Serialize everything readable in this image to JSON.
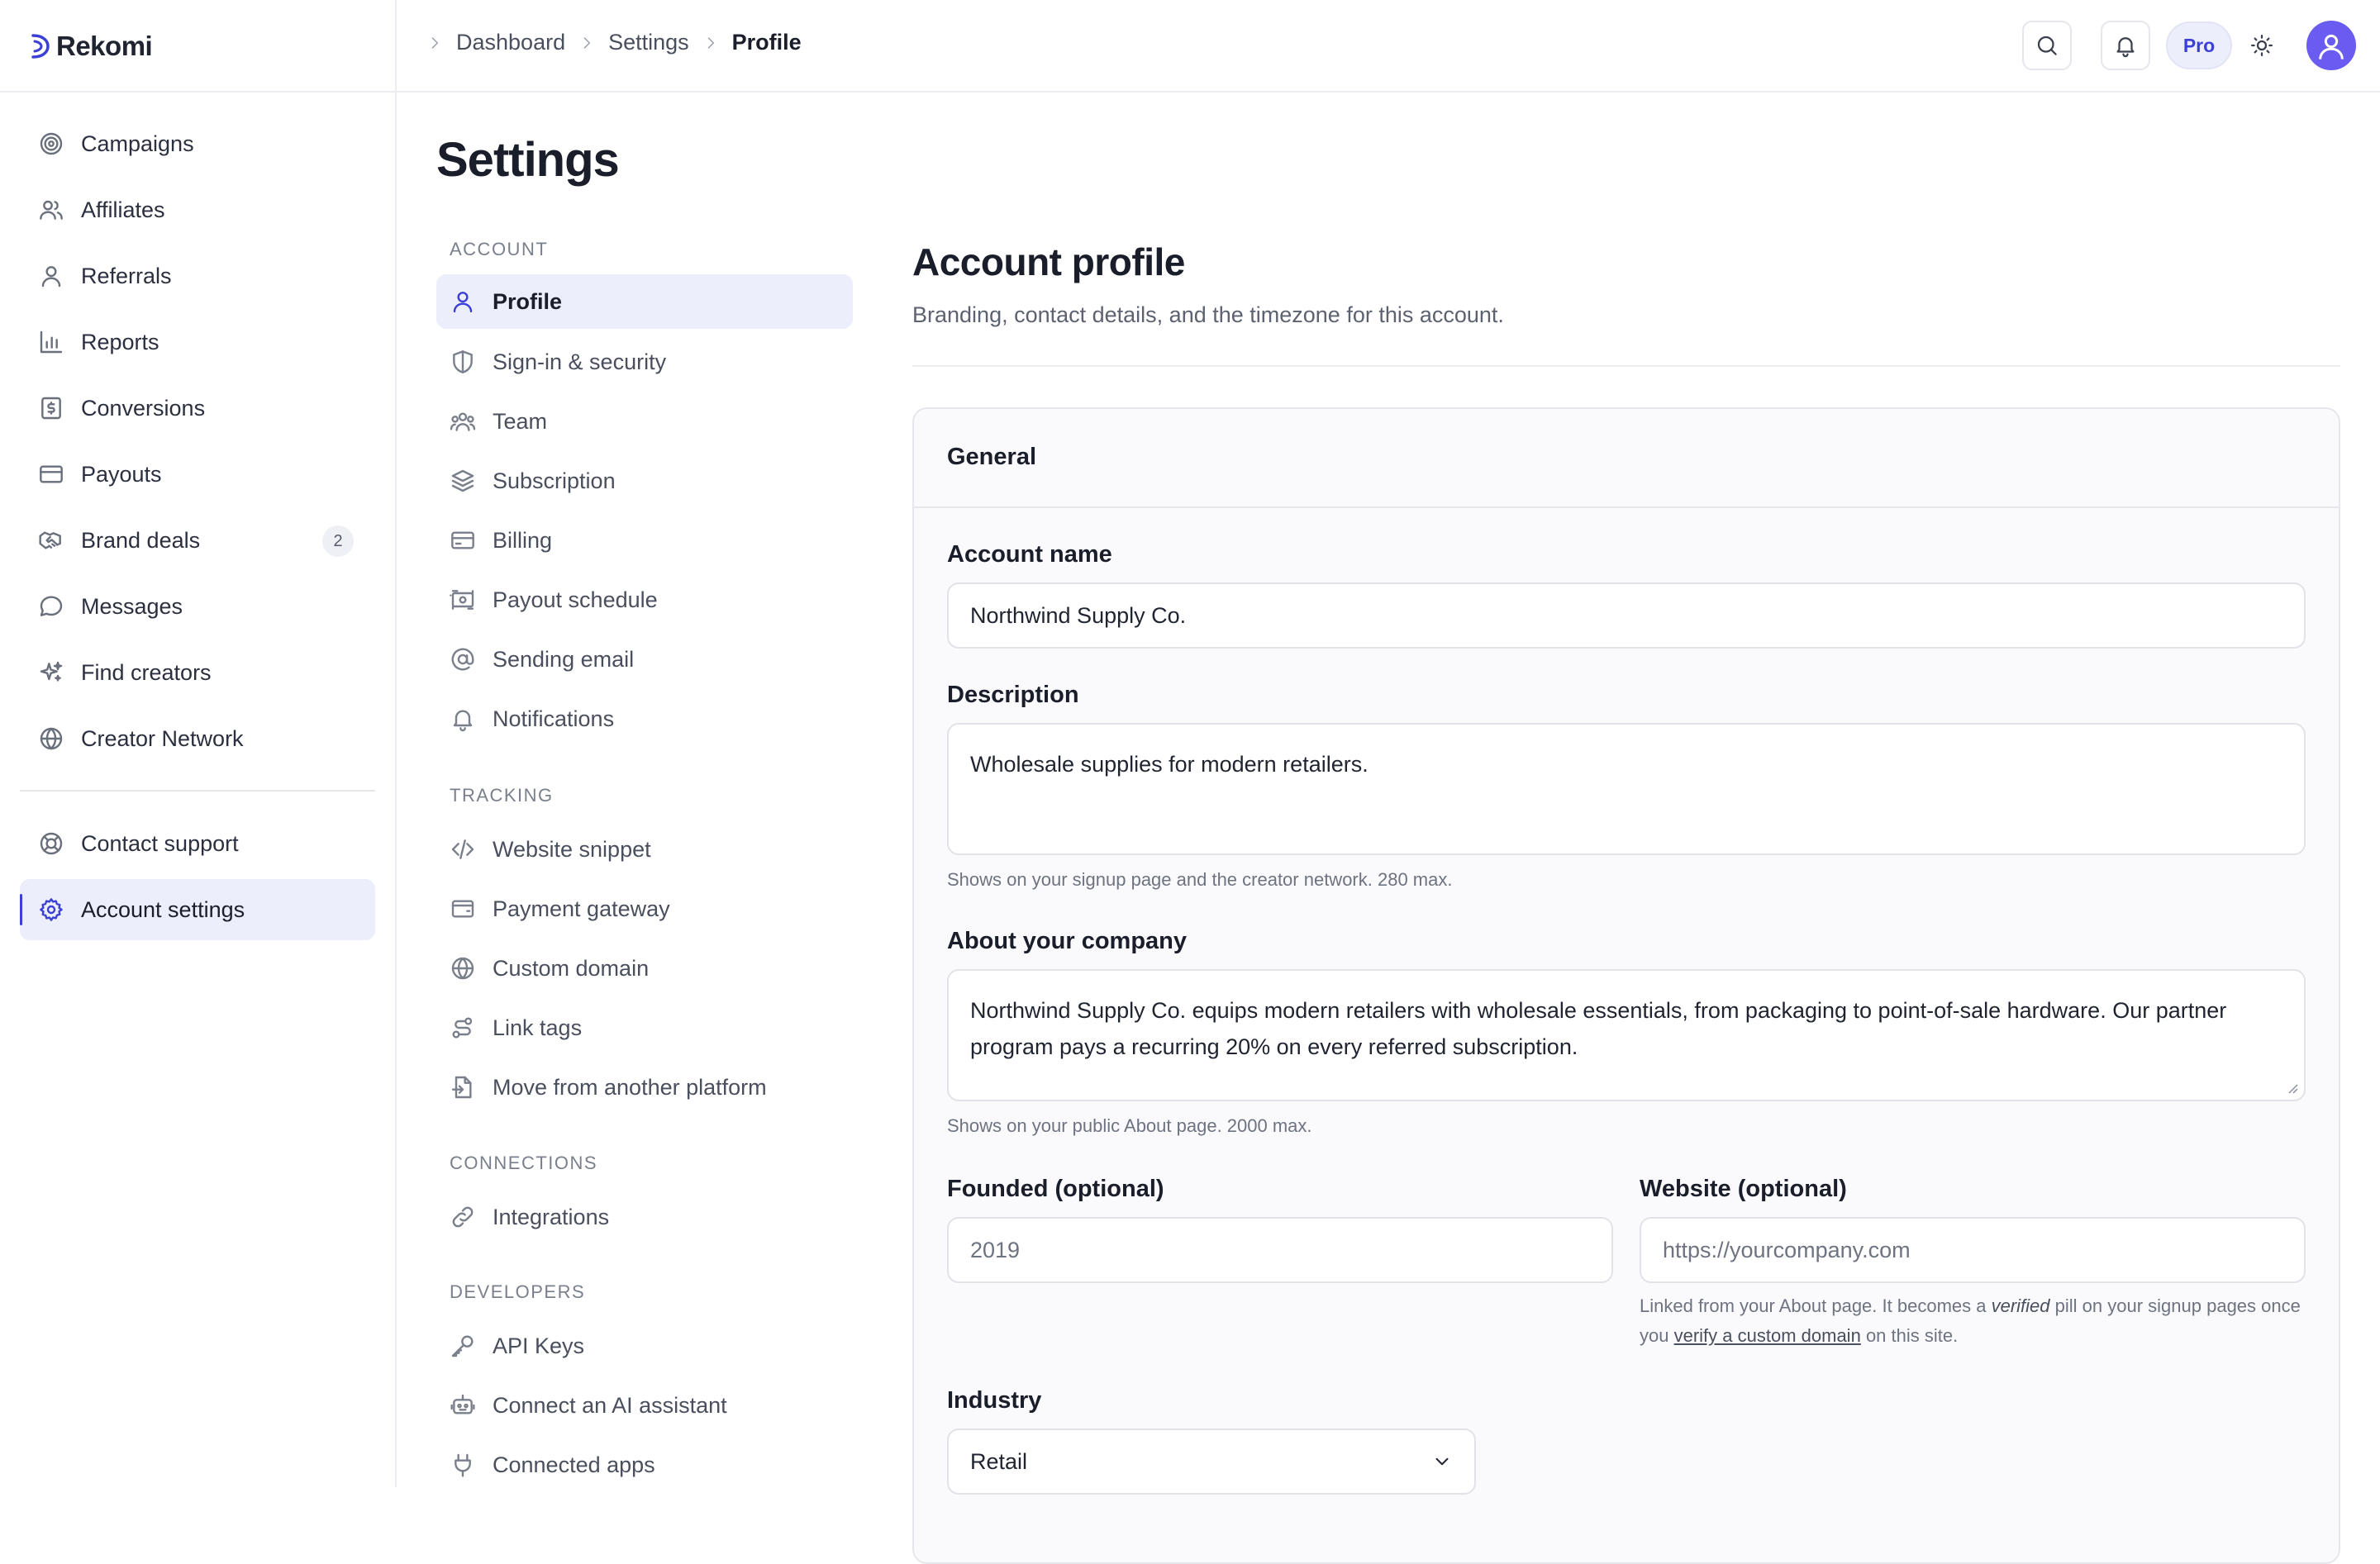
{
  "app": {
    "name": "Rekomi"
  },
  "sidebar": {
    "items": [
      {
        "label": "Campaigns",
        "icon": "target-icon"
      },
      {
        "label": "Affiliates",
        "icon": "users-icon"
      },
      {
        "label": "Referrals",
        "icon": "user-icon"
      },
      {
        "label": "Reports",
        "icon": "bar-chart-icon"
      },
      {
        "label": "Conversions",
        "icon": "receipt-icon"
      },
      {
        "label": "Payouts",
        "icon": "credit-card-icon"
      },
      {
        "label": "Brand deals",
        "icon": "handshake-icon",
        "badge": "2"
      },
      {
        "label": "Messages",
        "icon": "chat-bubble-icon"
      },
      {
        "label": "Find creators",
        "icon": "sparkle-icon"
      },
      {
        "label": "Creator Network",
        "icon": "globe-icon"
      }
    ],
    "bottom_items": [
      {
        "label": "Contact support",
        "icon": "life-buoy-icon"
      },
      {
        "label": "Account settings",
        "icon": "gear-icon",
        "active": true
      }
    ]
  },
  "topbar": {
    "breadcrumb": [
      "Dashboard",
      "Settings",
      "Profile"
    ],
    "plan_badge": "Pro"
  },
  "settings": {
    "title": "Settings",
    "sections": [
      {
        "label": "ACCOUNT",
        "items": [
          "Profile",
          "Sign-in & security",
          "Team",
          "Subscription",
          "Billing",
          "Payout schedule",
          "Sending email",
          "Notifications"
        ]
      },
      {
        "label": "TRACKING",
        "items": [
          "Website snippet",
          "Payment gateway",
          "Custom domain",
          "Link tags",
          "Move from another platform"
        ]
      },
      {
        "label": "CONNECTIONS",
        "items": [
          "Integrations"
        ]
      },
      {
        "label": "DEVELOPERS",
        "items": [
          "API Keys",
          "Connect an AI assistant",
          "Connected apps"
        ]
      }
    ],
    "active_item": "Profile"
  },
  "main": {
    "title": "Account profile",
    "subtitle": "Branding, contact details, and the timezone for this account.",
    "card_title": "General",
    "fields": {
      "account_name": {
        "label": "Account name",
        "value": "Northwind Supply Co."
      },
      "description": {
        "label": "Description",
        "value": "Wholesale supplies for modern retailers.",
        "hint": "Shows on your signup page and the creator network. 280 max."
      },
      "about": {
        "label": "About your company",
        "value": "Northwind Supply Co. equips modern retailers with wholesale essentials, from packaging to point-of-sale hardware. Our partner program pays a recurring 20% on every referred subscription.",
        "hint": "Shows on your public About page. 2000 max."
      },
      "founded": {
        "label": "Founded (optional)",
        "placeholder": "2019"
      },
      "website": {
        "label": "Website (optional)",
        "placeholder": "https://yourcompany.com",
        "hint_part1": "Linked from your About page. It becomes a",
        "hint_em": "verified",
        "hint_part2": "pill on your signup pages once you",
        "hint_link": "verify a custom domain",
        "hint_part3": "on this site."
      },
      "industry": {
        "label": "Industry",
        "value": "Retail"
      }
    }
  },
  "colors": {
    "accent": "#3b3fd4",
    "active_bg": "#eceefc",
    "avatar": "#6a5cf0",
    "border": "#e6e7ec"
  }
}
